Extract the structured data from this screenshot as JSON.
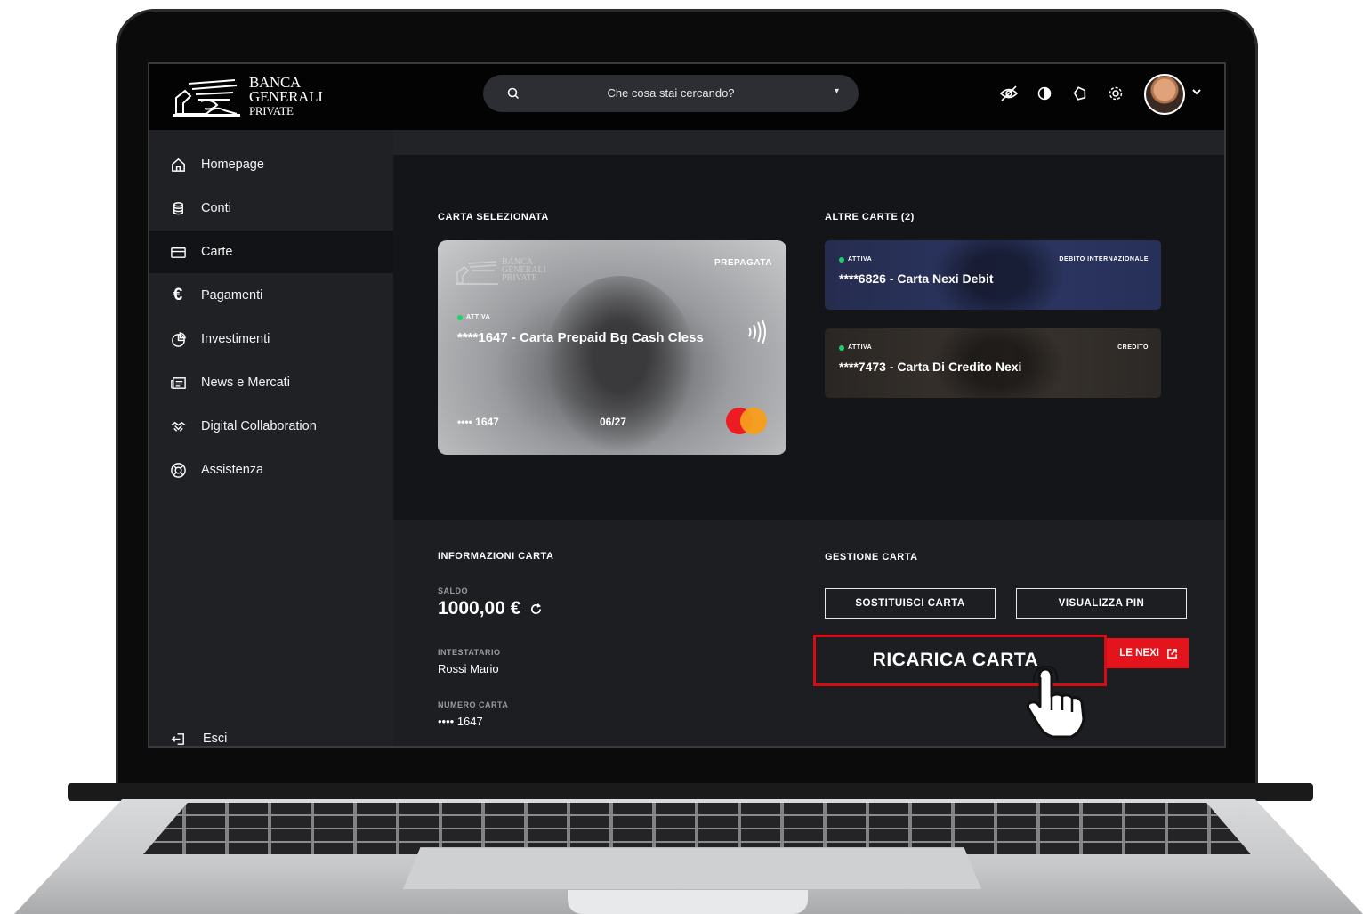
{
  "brand": {
    "line1": "BANCA",
    "line2": "GENERALI",
    "line3": "PRIVATE"
  },
  "search": {
    "placeholder": "Che cosa stai cercando?",
    "icon": "search-icon",
    "caret_icon": "caret-down-icon"
  },
  "topbar_icons": [
    "eye-off-icon",
    "contrast-icon",
    "bell-icon",
    "gear-icon"
  ],
  "sidebar": {
    "items": [
      {
        "label": "Homepage",
        "icon": "home-icon"
      },
      {
        "label": "Conti",
        "icon": "coins-icon"
      },
      {
        "label": "Carte",
        "icon": "card-icon",
        "active": true
      },
      {
        "label": "Pagamenti",
        "icon": "euro-icon"
      },
      {
        "label": "Investimenti",
        "icon": "pie-chart-icon"
      },
      {
        "label": "News e Mercati",
        "icon": "newspaper-icon"
      },
      {
        "label": "Digital Collaboration",
        "icon": "handshake-icon"
      },
      {
        "label": "Assistenza",
        "icon": "lifebuoy-icon"
      }
    ],
    "logout": "Esci"
  },
  "selected_card": {
    "section_title": "CARTA SELEZIONATA",
    "type": "PREPAGATA",
    "status": "ATTIVA",
    "name": "****1647 - Carta Prepaid Bg Cash Cless",
    "masked_number": "•••• 1647",
    "expiry": "06/27",
    "logo_text_1": "BANCA",
    "logo_text_2": "GENERALI",
    "logo_text_3": "PRIVATE"
  },
  "other_cards": {
    "section_title": "ALTRE CARTE (2)",
    "cards": [
      {
        "status": "ATTIVA",
        "type": "DEBITO INTERNAZIONALE",
        "name": "****6826 - Carta Nexi Debit"
      },
      {
        "status": "ATTIVA",
        "type": "CREDITO",
        "name": "****7473 - Carta Di Credito Nexi"
      }
    ]
  },
  "card_info": {
    "section_title": "INFORMAZIONI CARTA",
    "balance_label": "SALDO",
    "balance": "1000,00 €",
    "holder_label": "INTESTATARIO",
    "holder": "Rossi Mario",
    "number_label": "NUMERO CARTA",
    "number": "•••• 1647"
  },
  "card_management": {
    "section_title": "GESTIONE CARTA",
    "replace_button": "SOSTITUISCI CARTA",
    "pin_button": "VISUALIZZA PIN",
    "nexi_button_visible_text": "LE NEXI",
    "highlight_button": "RICARICA CARTA"
  },
  "colors": {
    "accent_red": "#e3141b",
    "status_green": "#22d06a",
    "debit_card": "#2c3662",
    "credit_card": "#3a342f"
  }
}
